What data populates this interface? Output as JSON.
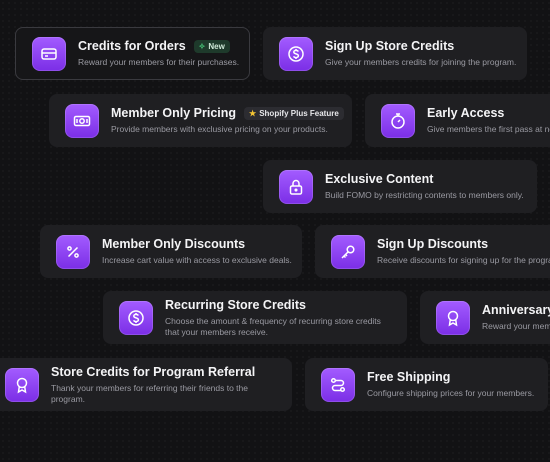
{
  "cards": {
    "credits_for_orders": {
      "title": "Credits for Orders",
      "desc": "Reward your members for their purchases.",
      "badge": "New"
    },
    "sign_up_store_credits": {
      "title": "Sign Up Store Credits",
      "desc": "Give your members credits for joining the program."
    },
    "member_only_pricing": {
      "title": "Member Only Pricing",
      "desc": "Provide members with exclusive pricing on your products.",
      "badge": "Shopify Plus Feature"
    },
    "early_access": {
      "title": "Early Access",
      "desc": "Give members the first pass at ne"
    },
    "exclusive_content": {
      "title": "Exclusive Content",
      "desc": "Build FOMO by restricting contents to members only."
    },
    "member_only_discounts": {
      "title": "Member Only Discounts",
      "desc": "Increase cart value with access to exclusive deals."
    },
    "sign_up_discounts": {
      "title": "Sign Up Discounts",
      "desc": "Receive discounts for signing up for the progra"
    },
    "recurring_store_credits": {
      "title": "Recurring Store Credits",
      "desc_line1": "Choose the amount & frequency of recurring store credits",
      "desc_line2": "that your members receive."
    },
    "anniversary": {
      "title": "Anniversary C",
      "desc": "Reward your memb"
    },
    "store_credits_referral": {
      "title": "Store Credits for Program Referral",
      "desc_line1": "Thank your members for referring their friends to the",
      "desc_line2": "program."
    },
    "free_shipping": {
      "title": "Free Shipping",
      "desc": "Configure shipping prices for your members."
    }
  },
  "icons": {
    "credits_for_orders": "credit-card-icon",
    "sign_up_store_credits": "dollar-circle-icon",
    "member_only_pricing": "banknote-icon",
    "early_access": "stopwatch-icon",
    "exclusive_content": "lock-icon",
    "member_only_discounts": "percent-icon",
    "sign_up_discounts": "key-icon",
    "recurring_store_credits": "dollar-circle-icon",
    "anniversary": "award-icon",
    "store_credits_referral": "award-icon",
    "free_shipping": "route-icon"
  },
  "colors": {
    "background": "#121214",
    "card": "#1f1f22",
    "accent": "#8a3ffc",
    "badge_new": "#1e3a2b",
    "star": "#f5c533"
  }
}
